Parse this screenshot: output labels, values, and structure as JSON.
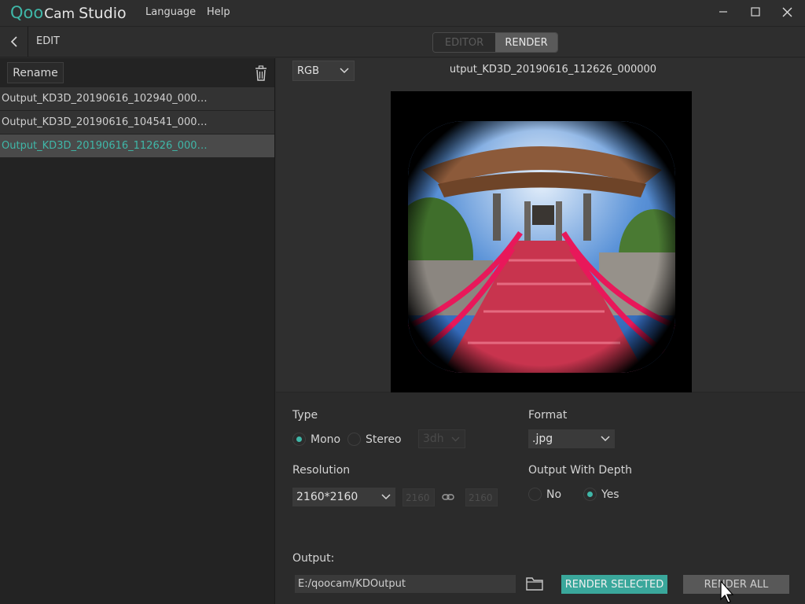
{
  "app": {
    "logo_q": "Qoo",
    "logo_cam": "Cam",
    "logo_studio": "Studio",
    "menu": [
      "Language",
      "Help"
    ]
  },
  "header": {
    "back_icon": "chevron-left-icon",
    "section": "EDIT",
    "mode_tabs": [
      {
        "label": "EDITOR",
        "active": false
      },
      {
        "label": "RENDER",
        "active": true
      }
    ]
  },
  "sidebar": {
    "rename_label": "Rename",
    "delete_icon": "trash-icon",
    "files": [
      {
        "name": "Output_KD3D_20190616_102940_000…",
        "selected": false
      },
      {
        "name": "Output_KD3D_20190616_104541_000…",
        "selected": false
      },
      {
        "name": "Output_KD3D_20190616_112626_000…",
        "selected": true
      }
    ]
  },
  "preview": {
    "channel": "RGB",
    "title": "utput_KD3D_20190616_112626_000000"
  },
  "settings": {
    "type": {
      "label": "Type",
      "options": [
        {
          "label": "Mono",
          "checked": true
        },
        {
          "label": "Stereo",
          "checked": false
        }
      ],
      "stereo_mode": "3dh"
    },
    "format": {
      "label": "Format",
      "value": ".jpg"
    },
    "resolution": {
      "label": "Resolution",
      "value": "2160*2160",
      "width": "2160",
      "height": "2160",
      "link_icon": "link-icon"
    },
    "depth": {
      "label": "Output With Depth",
      "options": [
        {
          "label": "No",
          "checked": false
        },
        {
          "label": "Yes",
          "checked": true
        }
      ]
    },
    "output": {
      "label": "Output:",
      "path": "E:/qoocam/KDOutput",
      "folder_icon": "folder-icon"
    }
  },
  "actions": {
    "render_selected": "RENDER SELECTED",
    "render_all": "RENDER ALL"
  },
  "colors": {
    "accent": "#3fb7a8",
    "render_selected_bg": "#3aa79b"
  }
}
